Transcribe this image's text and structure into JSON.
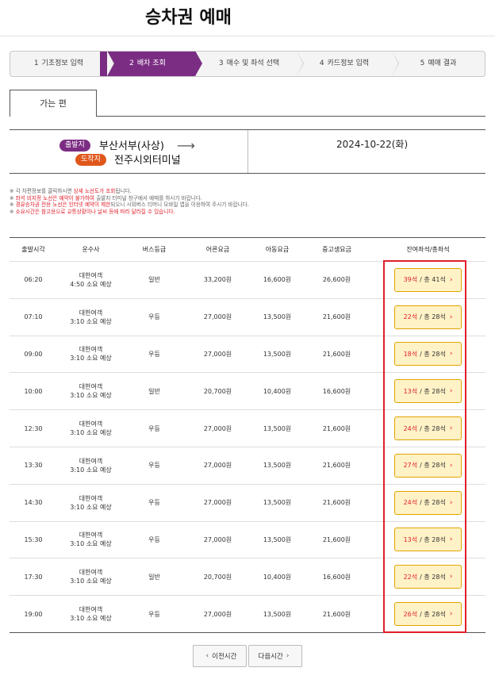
{
  "page": {
    "title": "승차권 예매"
  },
  "steps": [
    {
      "num": "1",
      "label": "기초정보 입력",
      "active": false
    },
    {
      "num": "2",
      "label": "배차 조회",
      "active": true
    },
    {
      "num": "3",
      "label": "매수 및 좌석 선택",
      "active": false
    },
    {
      "num": "4",
      "label": "카드정보 입력",
      "active": false
    },
    {
      "num": "5",
      "label": "예매 결과",
      "active": false
    }
  ],
  "tab": {
    "label": "가는 편"
  },
  "route": {
    "departure_badge": "출발지",
    "departure": "부산서부(사상)",
    "arrival_badge": "도착지",
    "arrival": "전주시외터미널",
    "arrow": "⟶",
    "date": "2024-10-22(화)"
  },
  "notices": [
    {
      "pre": "※ 각 차편정보를 클릭하시면 ",
      "hl": "상세 노선도가 조회",
      "post": "됩니다."
    },
    {
      "pre": "※ ",
      "hl": "좌석 비지정 노선은 예약이 불가하여",
      "post": " 출발지 터미널 창구에서 예매를 하시기 바랍니다."
    },
    {
      "pre": "※ ",
      "hl": "경유승차권 전용 노선은 인터넷 예약이 제한",
      "post": "되오니 시외버스 티머니 모바일 앱을 이용하여 주시기 바랍니다."
    },
    {
      "pre": "※ ",
      "hl": "소요시간은 참고용으로 교통상황이나 날씨 등에 따라 달라질 수 있습니다.",
      "post": ""
    }
  ],
  "table": {
    "headers": [
      "출발시각",
      "운수사",
      "버스등급",
      "어른요금",
      "아동요금",
      "중고생요금",
      "잔여좌석/총좌석"
    ],
    "rows": [
      {
        "time": "06:20",
        "company": "대한여객",
        "duration": "4:50 소요 예상",
        "grade": "일반",
        "adult": "33,200원",
        "child": "16,600원",
        "teen": "26,600원",
        "remaining": "39석",
        "total": "/ 총 41석"
      },
      {
        "time": "07:10",
        "company": "대한여객",
        "duration": "3:10 소요 예상",
        "grade": "우등",
        "adult": "27,000원",
        "child": "13,500원",
        "teen": "21,600원",
        "remaining": "22석",
        "total": "/ 총 28석"
      },
      {
        "time": "09:00",
        "company": "대한여객",
        "duration": "3:10 소요 예상",
        "grade": "우등",
        "adult": "27,000원",
        "child": "13,500원",
        "teen": "21,600원",
        "remaining": "18석",
        "total": "/ 총 28석"
      },
      {
        "time": "10:00",
        "company": "대한여객",
        "duration": "3:10 소요 예상",
        "grade": "일반",
        "adult": "20,700원",
        "child": "10,400원",
        "teen": "16,600원",
        "remaining": "13석",
        "total": "/ 총 28석"
      },
      {
        "time": "12:30",
        "company": "대한여객",
        "duration": "3:10 소요 예상",
        "grade": "우등",
        "adult": "27,000원",
        "child": "13,500원",
        "teen": "21,600원",
        "remaining": "24석",
        "total": "/ 총 28석"
      },
      {
        "time": "13:30",
        "company": "대한여객",
        "duration": "3:10 소요 예상",
        "grade": "우등",
        "adult": "27,000원",
        "child": "13,500원",
        "teen": "21,600원",
        "remaining": "27석",
        "total": "/ 총 28석"
      },
      {
        "time": "14:30",
        "company": "대한여객",
        "duration": "3:10 소요 예상",
        "grade": "우등",
        "adult": "27,000원",
        "child": "13,500원",
        "teen": "21,600원",
        "remaining": "24석",
        "total": "/ 총 28석"
      },
      {
        "time": "15:30",
        "company": "대한여객",
        "duration": "3:10 소요 예상",
        "grade": "우등",
        "adult": "27,000원",
        "child": "13,500원",
        "teen": "21,600원",
        "remaining": "13석",
        "total": "/ 총 28석"
      },
      {
        "time": "17:30",
        "company": "대한여객",
        "duration": "3:10 소요 예상",
        "grade": "일반",
        "adult": "20,700원",
        "child": "10,400원",
        "teen": "16,600원",
        "remaining": "22석",
        "total": "/ 총 28석"
      },
      {
        "time": "19:00",
        "company": "대한여객",
        "duration": "3:10 소요 예상",
        "grade": "우등",
        "adult": "27,000원",
        "child": "13,500원",
        "teen": "21,600원",
        "remaining": "26석",
        "total": "/ 총 28석"
      }
    ]
  },
  "paging": {
    "prev_label": "이전시간",
    "next_label": "다음시간",
    "prev_icon": "‹",
    "next_icon": "›"
  },
  "seat_chevron": "›",
  "colors": {
    "accent": "#7b2d83",
    "arrival": "#e0571b",
    "seat_bg": "#fff2c6",
    "seat_border": "#e2a400",
    "highlight": "#e01e2a"
  }
}
